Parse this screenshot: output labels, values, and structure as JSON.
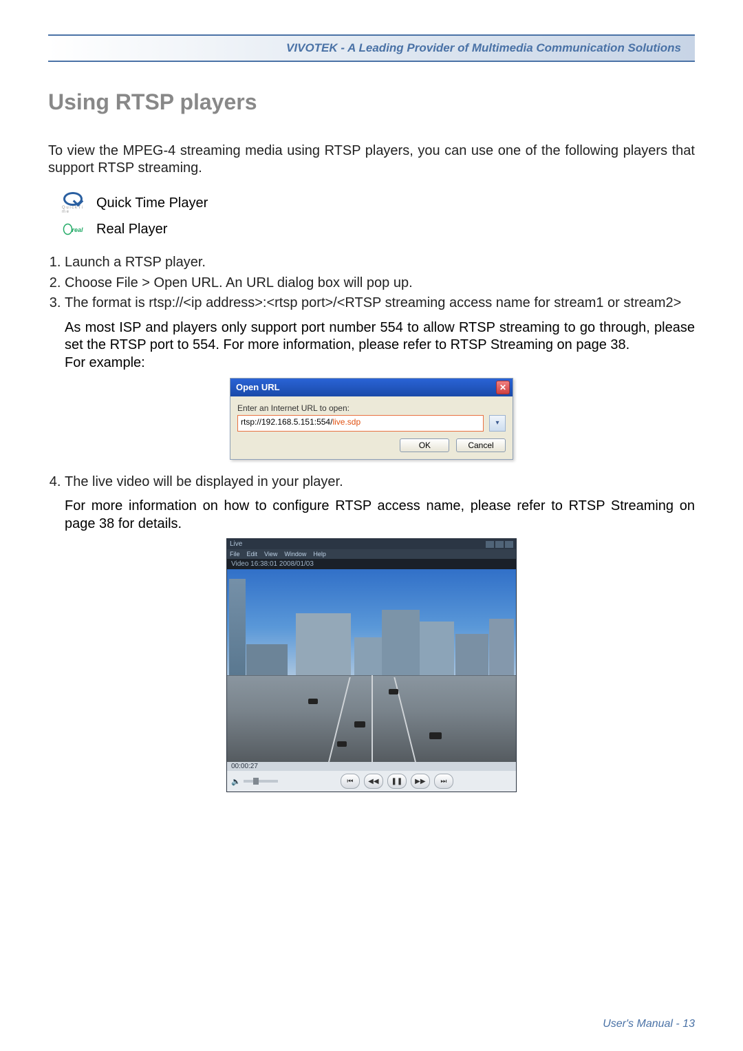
{
  "header": {
    "brand_tagline": "VIVOTEK - A Leading Provider of Multimedia Communication Solutions"
  },
  "section": {
    "title": "Using RTSP players",
    "intro": "To view the MPEG-4 streaming media using RTSP players, you can use one of the following players that support RTSP streaming.",
    "players": {
      "quicktime": "Quick Time Player",
      "real": "Real Player"
    },
    "steps": {
      "s1": "Launch a RTSP player.",
      "s2": "Choose File > Open URL. An URL dialog box will pop up.",
      "s3": "The format is rtsp://<ip address>:<rtsp port>/<RTSP streaming access name for stream1 or stream2>",
      "s3_detail": "As most ISP and players only support port number 554 to allow RTSP streaming to go through, please set the RTSP port to 554. For more information, please refer to RTSP Streaming on page 38.",
      "s3_for_example": "For example:",
      "s4": "The live video will be displayed in your player.",
      "s4_detail": "For more information on how to configure RTSP access name, please refer to RTSP Streaming on page 38 for details."
    }
  },
  "dialog": {
    "title": "Open URL",
    "label": "Enter an Internet URL to open:",
    "url_prefix": "rtsp://192.168.5.151:554/",
    "url_highlight": "live.sdp",
    "ok": "OK",
    "cancel": "Cancel"
  },
  "player_window": {
    "title_text": "Live",
    "menu": {
      "file": "File",
      "edit": "Edit",
      "view": "View",
      "window": "Window",
      "help": "Help"
    },
    "overlay": "Video 16:38:01 2008/01/03",
    "timecode": "00:00:27"
  },
  "footer": {
    "text": "User's Manual - 13"
  }
}
